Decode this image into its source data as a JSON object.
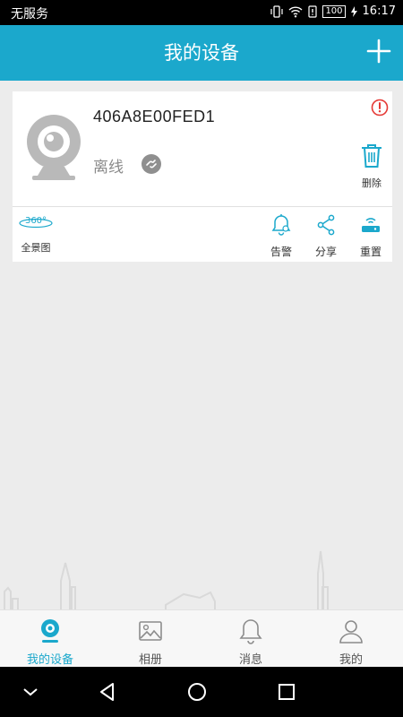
{
  "status_bar": {
    "carrier": "无服务",
    "battery": "100",
    "time": "16:17"
  },
  "header": {
    "title": "我的设备"
  },
  "device": {
    "id": "406A8E00FED1",
    "status": "离线",
    "delete_label": "删除",
    "panorama_icon_text": "360°",
    "panorama_label": "全景图",
    "actions": {
      "alarm": "告警",
      "share": "分享",
      "reset": "重置"
    }
  },
  "bottom_nav": {
    "items": [
      {
        "label": "我的设备",
        "icon": "camera-icon",
        "active": true
      },
      {
        "label": "相册",
        "icon": "album-icon",
        "active": false
      },
      {
        "label": "消息",
        "icon": "bell-icon",
        "active": false
      },
      {
        "label": "我的",
        "icon": "user-icon",
        "active": false
      }
    ]
  },
  "colors": {
    "accent": "#1ba8cc",
    "alert": "#e53935",
    "offline": "#8a8a8a"
  }
}
